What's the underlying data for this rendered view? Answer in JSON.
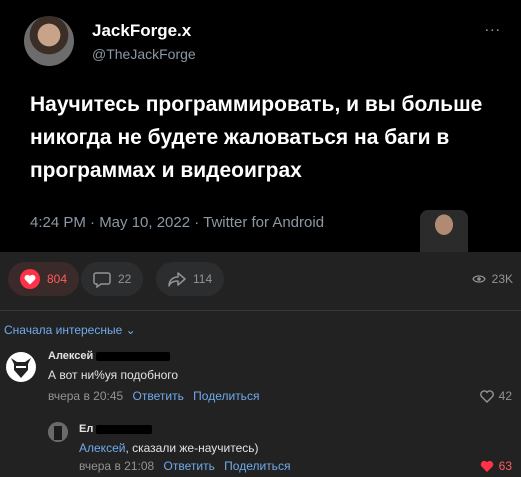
{
  "tweet": {
    "author": "JackForge.x",
    "handle": "@TheJackForge",
    "more": "...",
    "text": "Научитесь программировать, и вы больше никогда не будете жаловаться на баги в программах и видеоиграх",
    "meta": "4:24 PM · May 10, 2022 · Twitter for Android"
  },
  "actions": {
    "likes": "804",
    "comments": "22",
    "shares": "114",
    "views": "23K"
  },
  "sort_label": "Сначала интересные",
  "comments": [
    {
      "author": "Алексей",
      "text": "А вот ни%уя подобного",
      "time": "вчера в 20:45",
      "reply": "Ответить",
      "share": "Поделиться",
      "likes": "42"
    },
    {
      "author": "Ел",
      "mention": "Алексей",
      "text": ", сказали же-научитесь)",
      "time": "вчера в 21:08",
      "reply": "Ответить",
      "share": "Поделиться",
      "likes": "63"
    }
  ],
  "colors": {
    "accent": "#71aaeb",
    "like": "#ff3347",
    "background": "#222222"
  }
}
